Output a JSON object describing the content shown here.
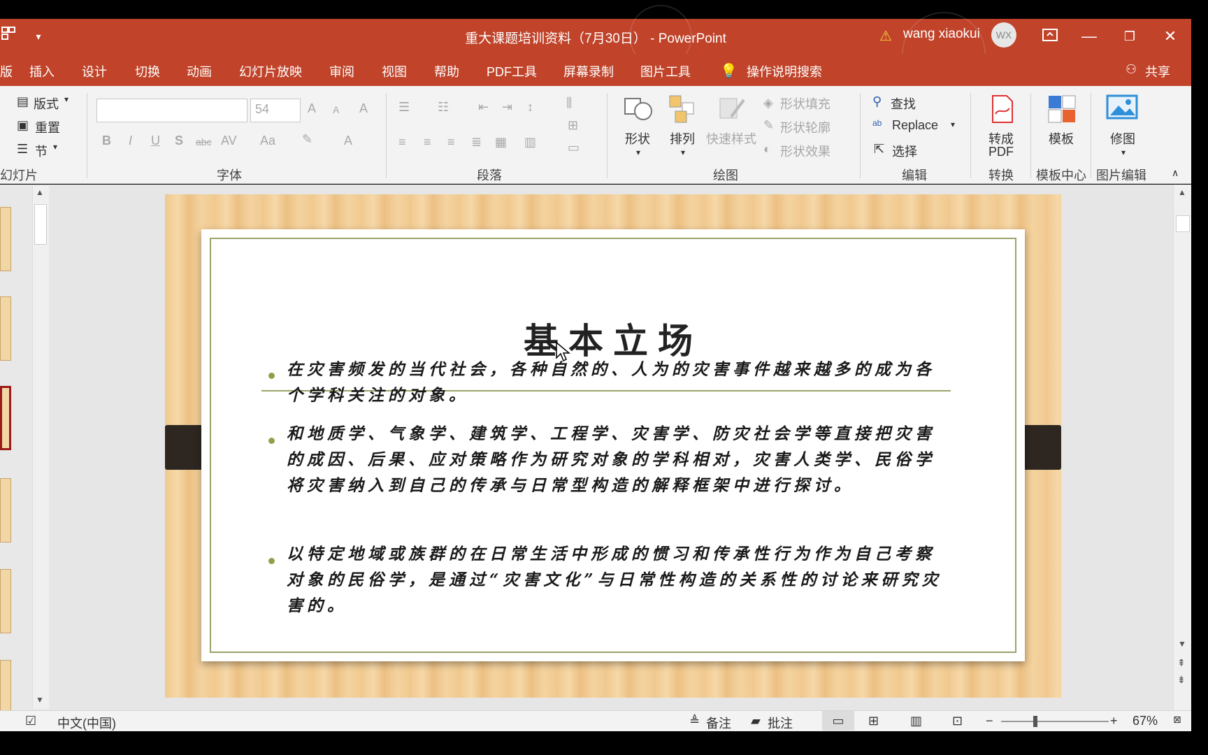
{
  "window": {
    "title": "重大课题培训资料（7月30日） - PowerPoint",
    "user_name": "wang xiaokui",
    "user_initials": "WX"
  },
  "menu": {
    "partial_first": "版",
    "items": [
      "插入",
      "设计",
      "切换",
      "动画",
      "幻灯片放映",
      "审阅",
      "视图",
      "帮助",
      "PDF工具",
      "屏幕录制",
      "图片工具"
    ],
    "search": "操作说明搜索",
    "share": "共享"
  },
  "ribbon": {
    "slides": {
      "layout": "版式",
      "reset": "重置",
      "section": "节",
      "label": "幻灯片"
    },
    "font": {
      "size": "54",
      "label": "字体",
      "bold": "B",
      "italic": "I",
      "underline": "U",
      "shadow": "S",
      "strike": "abc",
      "spacing": "AV",
      "case": "Aa",
      "grow": "A",
      "shrink": "A",
      "clear": "A"
    },
    "paragraph": {
      "label": "段落"
    },
    "drawing": {
      "shapes": "形状",
      "arrange": "排列",
      "quick_styles": "快速样式",
      "fill": "形状填充",
      "outline": "形状轮廓",
      "effects": "形状效果",
      "label": "绘图"
    },
    "editing": {
      "find": "查找",
      "replace": "Replace",
      "select": "选择",
      "label": "编辑"
    },
    "convert": {
      "button_line1": "转成",
      "button_line2": "PDF",
      "label": "转换"
    },
    "template": {
      "button": "模板",
      "label": "模板中心"
    },
    "image": {
      "button": "修图",
      "label": "图片编辑"
    }
  },
  "slide": {
    "title": "基本立场",
    "bullets": [
      "在灾害频发的当代社会，各种自然的、人为的灾害事件越来越多的成为各个学科关注的对象。",
      "和地质学、气象学、建筑学、工程学、灾害学、防灾社会学等直接把灾害的成因、后果、应对策略作为研究对象的学科相对，灾害人类学、民俗学将灾害纳入到自己的传承与日常型构造的解释框架中进行探讨。",
      "以特定地域或族群的在日常生活中形成的惯习和传承性行为作为自己考察对象的民俗学，是通过“灾害文化”与日常性构造的关系性的讨论来研究灾害的。"
    ]
  },
  "status": {
    "language": "中文(中国)",
    "notes": "备注",
    "comments": "批注",
    "zoom": "67%",
    "zoom_out": "−",
    "zoom_in": "+"
  },
  "colors": {
    "accent": "#c0432a",
    "frame": "#9aa36a",
    "bullet": "#8ea14a"
  }
}
